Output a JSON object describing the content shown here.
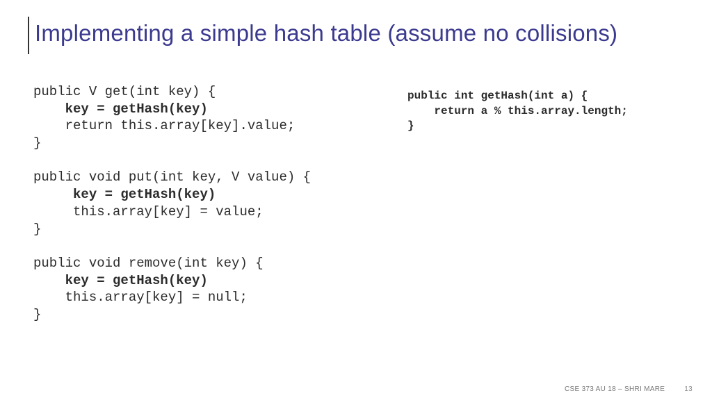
{
  "title": "Implementing a simple hash table (assume no collisions)",
  "code_left": {
    "get_sig": "public V get(int key) {",
    "get_body1": "    key = getHash(key)",
    "get_body2": "    return this.array[key].value;",
    "get_close": "}",
    "put_sig": "public void put(int key, V value) {",
    "put_body1": "     key = getHash(key)",
    "put_body2": "     this.array[key] = value;",
    "put_close": "}",
    "rm_sig": "public void remove(int key) {",
    "rm_body1": "    key = getHash(key)",
    "rm_body2": "    this.array[key] = null;",
    "rm_close": "}"
  },
  "code_right": {
    "hash_sig": "public int getHash(int a) {",
    "hash_body": "    return a % this.array.length;",
    "hash_close": "}"
  },
  "footer": {
    "course": "CSE 373 AU 18 – SHRI MARE",
    "page": "13"
  }
}
